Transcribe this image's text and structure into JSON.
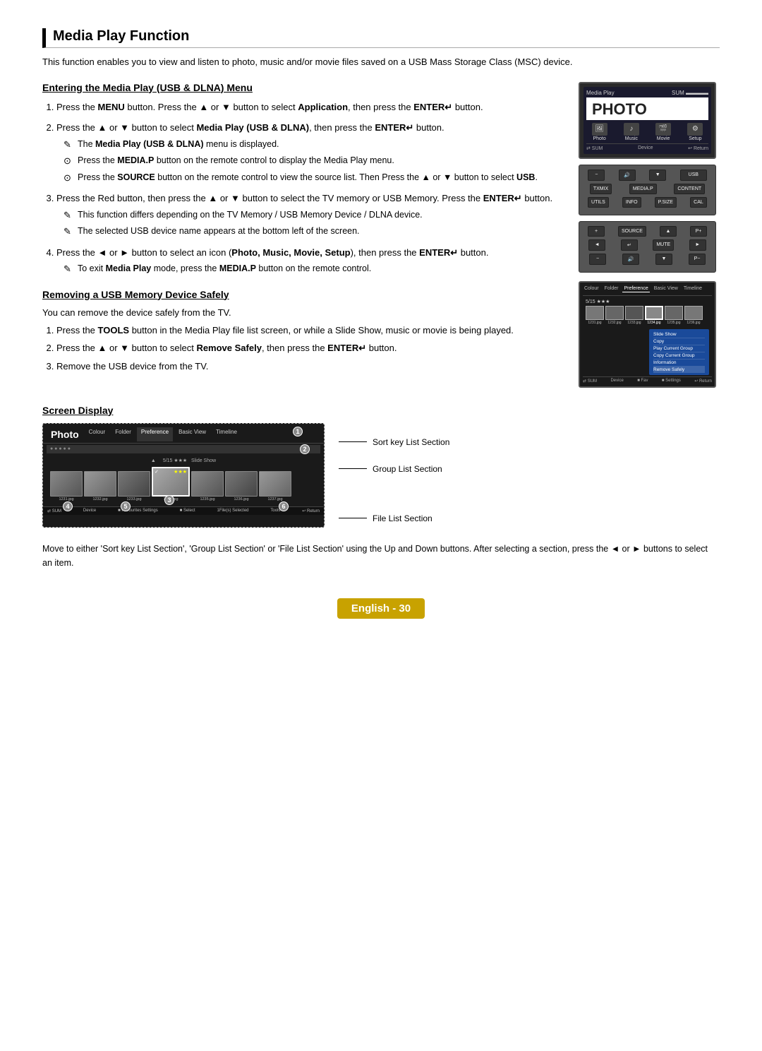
{
  "page": {
    "title": "Media Play Function",
    "intro": "This function enables you to view and listen to photo, music and/or movie files saved on a USB Mass Storage Class (MSC) device.",
    "sections": {
      "entering": {
        "title": "Entering the Media Play (USB & DLNA) Menu",
        "steps": [
          {
            "num": "1",
            "text": "Press the MENU button. Press the ▲ or ▼ button to select Application, then press the ENTER↵ button."
          },
          {
            "num": "2",
            "text": "Press the ▲ or ▼ button to select Media Play (USB & DLNA), then press the ENTER↵ button."
          },
          {
            "num": "3",
            "text": "Press the Red button, then press the ▲ or ▼ button to select the TV memory or USB Memory. Press the ENTER↵ button."
          },
          {
            "num": "4",
            "text": "Press the ◄ or ► button to select an icon (Photo, Music, Movie, Setup), then press the ENTER↵ button."
          }
        ],
        "notes_step2": [
          "The Media Play (USB & DLNA) menu is displayed.",
          "Press the MEDIA.P button on the remote control to display the Media Play menu.",
          "Press the SOURCE button on the remote control to view the source list. Then Press the ▲ or ▼ button to select USB."
        ],
        "notes_step3": [
          "This function differs depending on the TV Memory / USB Memory Device / DLNA device.",
          "The selected USB device name appears at the bottom left of the screen."
        ],
        "notes_step4": [
          "To exit Media Play mode, press the MEDIA.P button on the remote control."
        ]
      },
      "removing": {
        "title": "Removing a USB Memory Device Safely",
        "intro": "You can remove the device safely from the TV.",
        "steps": [
          "Press the TOOLS button in the Media Play file list screen, or while a Slide Show, music or movie is being played.",
          "Press the ▲ or ▼ button to select Remove Safely, then press the ENTER↵ button.",
          "Remove the USB device from the TV."
        ]
      },
      "screen_display": {
        "title": "Screen Display",
        "labels": {
          "sort_key": "Sort key List Section",
          "group_list": "Group List Section",
          "file_list": "File List Section"
        },
        "screen": {
          "title": "Photo",
          "tabs": [
            "Colour",
            "Folder",
            "Preference",
            "Basic View",
            "Timeline"
          ],
          "active_tab": "Preference",
          "file_names": [
            "1231.jpg",
            "1232.jpg",
            "1233.jpg",
            "1234.jpg",
            "1235.jpg",
            "1236.jpg",
            "1237.jpg"
          ],
          "selected_count": "1File(s) Selected",
          "bottom_bar": [
            "SUM",
            "Device",
            "Favourites Settings",
            "Select",
            "Tools",
            "Return"
          ],
          "badge_numbers": [
            "1",
            "2",
            "3",
            "4",
            "5",
            "6"
          ]
        },
        "footer_note": "Move to either 'Sort key List Section', 'Group List Section' or 'File List Section' using the Up and Down buttons. After selecting a section, press the ◄ or ► buttons to select an item."
      }
    },
    "footer": {
      "label": "English - 30"
    }
  }
}
